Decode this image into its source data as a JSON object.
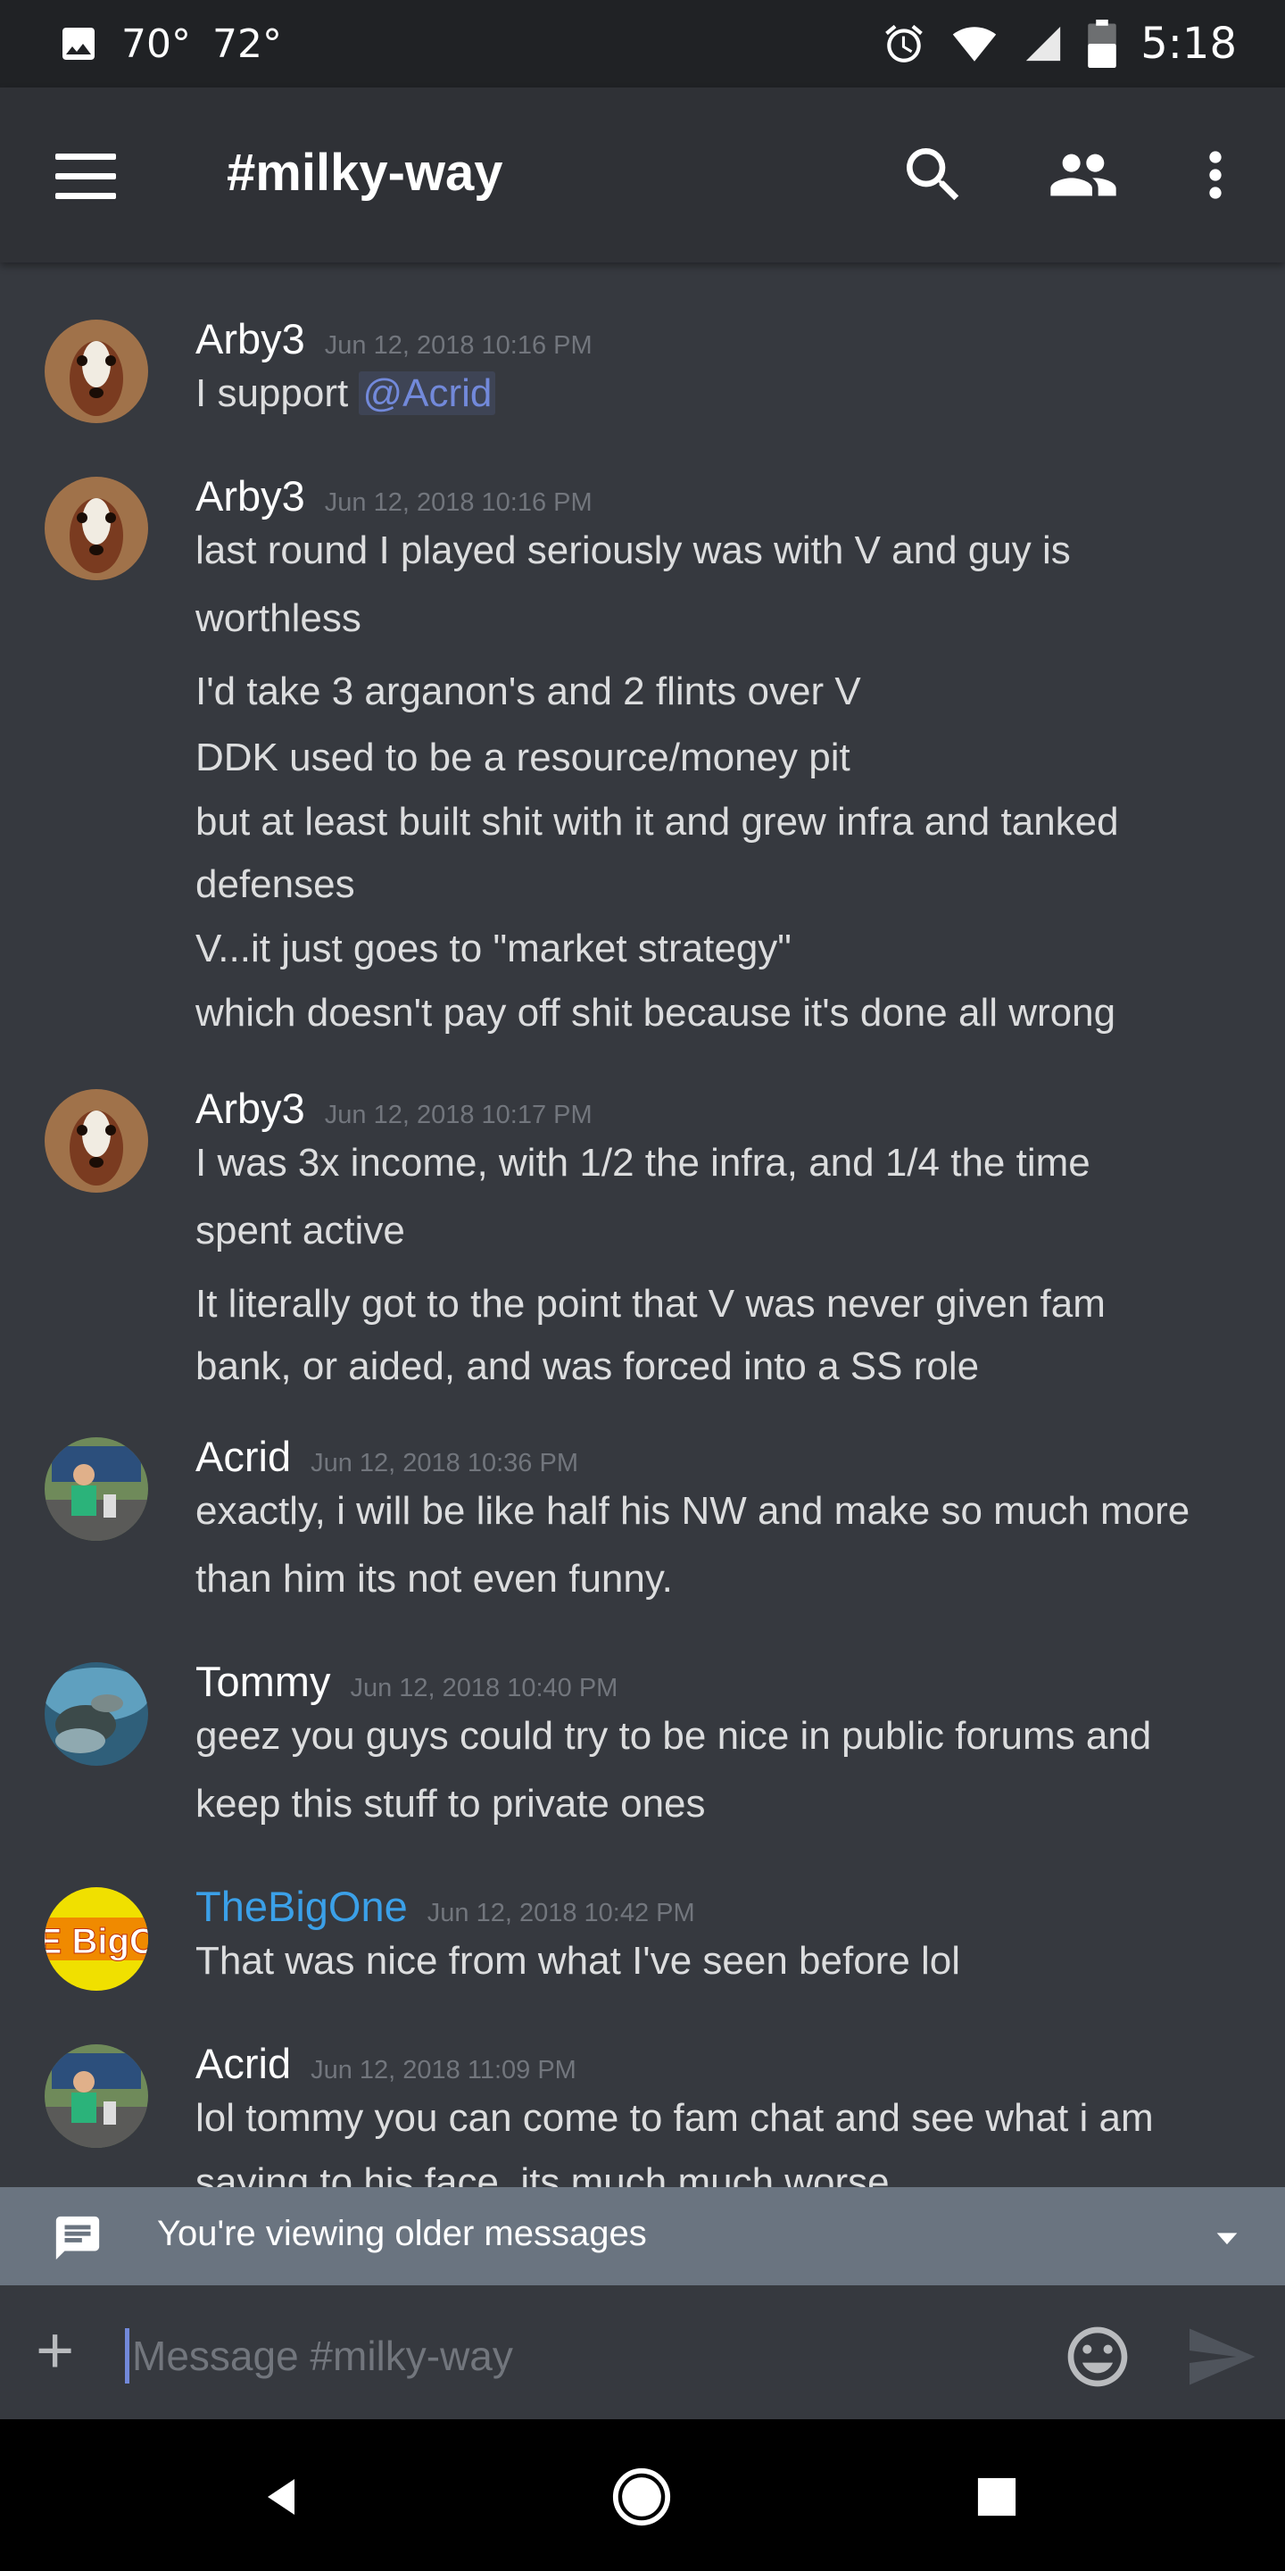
{
  "status_bar": {
    "temp1": "70°",
    "temp2": "72°",
    "time": "5:18"
  },
  "app_bar": {
    "channel_title": "#milky-way"
  },
  "messages": [
    {
      "author": "Arby3",
      "timestamp": "Jun 12, 2018 10:16 PM",
      "mention_prefix": "I support ",
      "mention": "@Acrid"
    },
    {
      "author": "Arby3",
      "timestamp": "Jun 12, 2018 10:16 PM",
      "lines": [
        "last round I played seriously was with V and guy is",
        "worthless",
        "I'd take 3 arganon's and 2 flints over V",
        "DDK used to be a resource/money pit",
        "but at least built shit with it and grew infra and tanked",
        "defenses",
        "V...it just goes to \"market strategy\"",
        "which doesn't pay off shit because it's done all wrong"
      ]
    },
    {
      "author": "Arby3",
      "timestamp": "Jun 12, 2018 10:17 PM",
      "lines": [
        "I was 3x income, with 1/2 the infra, and 1/4 the time",
        "spent active",
        "It literally got to the point that V was never given fam",
        "bank, or aided, and was forced into a SS role"
      ]
    },
    {
      "author": "Acrid",
      "timestamp": "Jun 12, 2018 10:36 PM",
      "lines": [
        "exactly, i will be like half his NW and make so much more",
        "than him its not even funny."
      ]
    },
    {
      "author": "Tommy",
      "timestamp": "Jun 12, 2018 10:40 PM",
      "lines": [
        "geez you guys could try to be nice in public forums and",
        "keep this stuff to private ones"
      ]
    },
    {
      "author": "TheBigOne",
      "timestamp": "Jun 12, 2018 10:42 PM",
      "author_color": "#3ba0e8",
      "avatar_text": "THE BigOne",
      "lines": [
        "That was nice from what I've seen before lol"
      ]
    },
    {
      "author": "Acrid",
      "timestamp": "Jun 12, 2018 11:09 PM",
      "lines": [
        "lol tommy you can come to fam chat and see what i am",
        "saying to his face, its much much worse"
      ]
    }
  ],
  "banner": {
    "text": "You're viewing older messages"
  },
  "composer": {
    "placeholder": "Message #milky-way"
  },
  "icons": {
    "status": [
      "image-icon",
      "alarm-icon",
      "wifi-icon",
      "signal-icon",
      "battery-icon"
    ],
    "app_bar": [
      "menu-icon",
      "search-icon",
      "members-icon",
      "more-vert-icon"
    ],
    "composer": [
      "plus-icon",
      "emoji-icon",
      "send-icon"
    ],
    "nav": [
      "back-icon",
      "home-icon",
      "recents-icon"
    ]
  },
  "colors": {
    "background": "#36393f",
    "app_bar": "#2f3136",
    "status_bar": "#202225",
    "mention": "#7289da",
    "banner": "#6a7480",
    "link_user": "#3ba0e8"
  }
}
